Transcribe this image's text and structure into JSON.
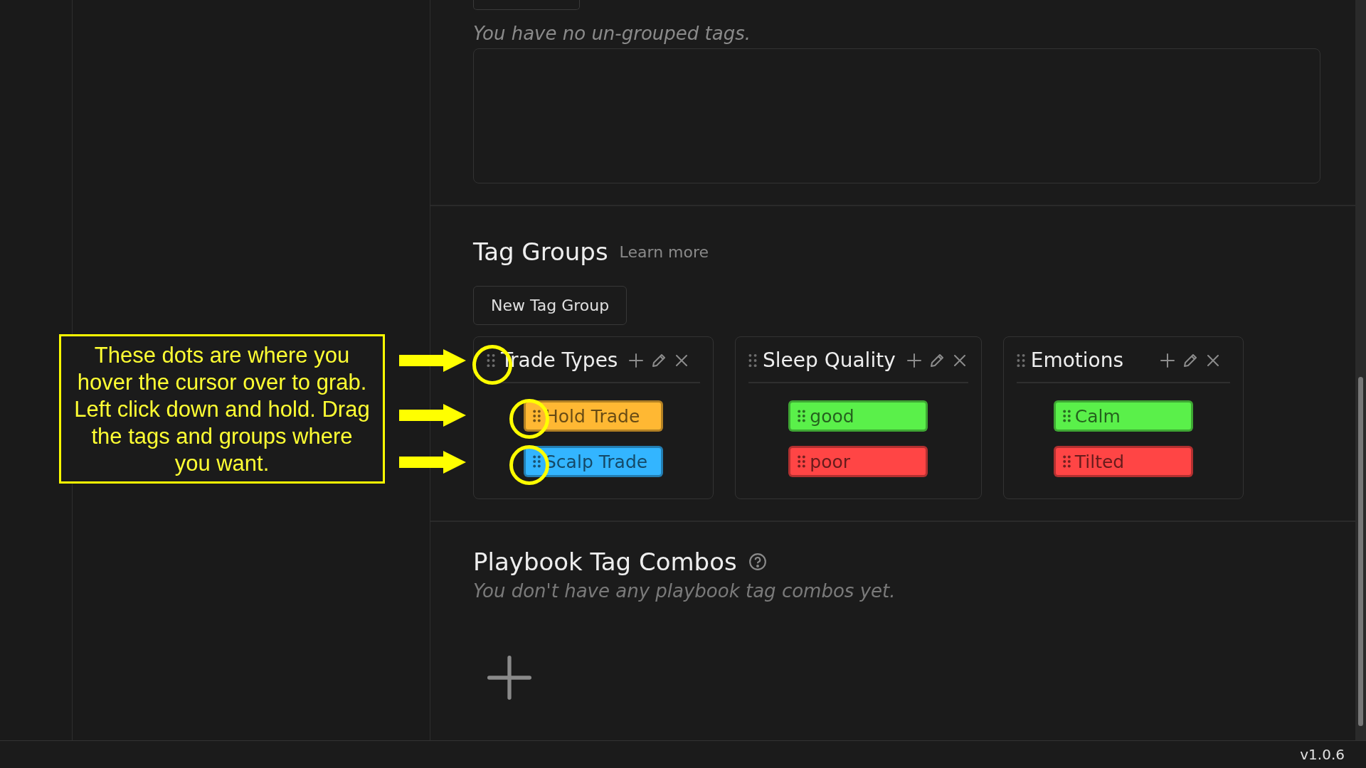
{
  "ungrouped": {
    "empty_text": "You have no un-grouped tags."
  },
  "tag_groups": {
    "title": "Tag Groups",
    "learn_more": "Learn more",
    "new_button": "New Tag Group",
    "groups": [
      {
        "name": "Trade Types",
        "tags": [
          {
            "label": "Hold Trade",
            "color": "#ffb833"
          },
          {
            "label": "Scalp Trade",
            "color": "#33b5ff"
          }
        ]
      },
      {
        "name": "Sleep Quality",
        "tags": [
          {
            "label": "good",
            "color": "#5af04a"
          },
          {
            "label": "poor",
            "color": "#ff4545"
          }
        ]
      },
      {
        "name": "Emotions",
        "tags": [
          {
            "label": "Calm",
            "color": "#5af04a"
          },
          {
            "label": "Tilted",
            "color": "#ff4545"
          }
        ]
      }
    ]
  },
  "playbook_combos": {
    "title": "Playbook Tag Combos",
    "empty_text": "You don't have any playbook tag combos yet."
  },
  "annotation": {
    "text": "These dots are where you hover the cursor over to grab. Left click down and hold. Drag the tags and groups where you want."
  },
  "status_bar": {
    "version": "v1.0.6"
  }
}
